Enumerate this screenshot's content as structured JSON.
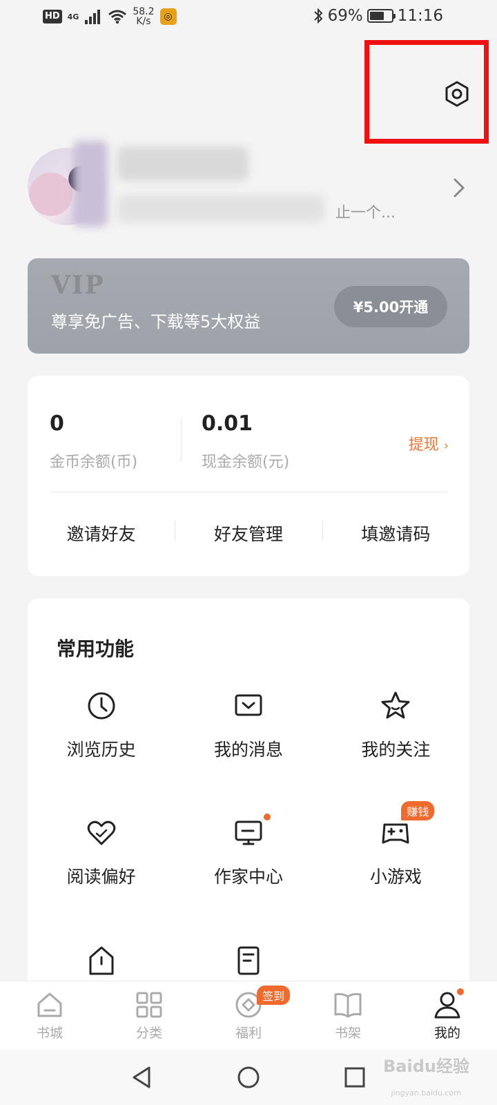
{
  "status_bar": {
    "hd": "HD",
    "network": "4G",
    "speed_value": "58.2",
    "speed_unit": "K/s",
    "battery_text": "69%",
    "battery_level": 0.69,
    "time": "11:16"
  },
  "profile": {
    "description_tail": "止一个..."
  },
  "vip": {
    "logo": "VIP",
    "subtitle": "尊享免广告、下载等5大权益",
    "button": "¥5.00开通"
  },
  "wallet": {
    "coins_value": "0",
    "coins_label": "金币余额(币)",
    "cash_value": "0.01",
    "cash_label": "现金余额(元)",
    "withdraw_label": "提现",
    "actions": [
      "邀请好友",
      "好友管理",
      "填邀请码"
    ]
  },
  "features": {
    "title": "常用功能",
    "items": [
      {
        "label": "浏览历史",
        "icon": "clock-icon"
      },
      {
        "label": "我的消息",
        "icon": "message-icon"
      },
      {
        "label": "我的关注",
        "icon": "star-icon"
      },
      {
        "label": "阅读偏好",
        "icon": "heart-icon"
      },
      {
        "label": "作家中心",
        "icon": "monitor-icon"
      },
      {
        "label": "小游戏",
        "icon": "gamepad-icon",
        "badge": "赚钱"
      }
    ]
  },
  "bottom_nav": {
    "items": [
      {
        "label": "书城",
        "icon": "home-icon"
      },
      {
        "label": "分类",
        "icon": "grid-icon"
      },
      {
        "label": "福利",
        "icon": "coin-icon",
        "badge": "签到"
      },
      {
        "label": "书架",
        "icon": "book-icon"
      },
      {
        "label": "我的",
        "icon": "user-icon",
        "active": true
      }
    ]
  },
  "colors": {
    "accent": "#f06a2e",
    "highlight": "#f20f0f",
    "vip_bg": "#a4a7ae"
  },
  "watermark": {
    "text": "Baidu经验",
    "sub": "jingyan.baidu.com"
  }
}
